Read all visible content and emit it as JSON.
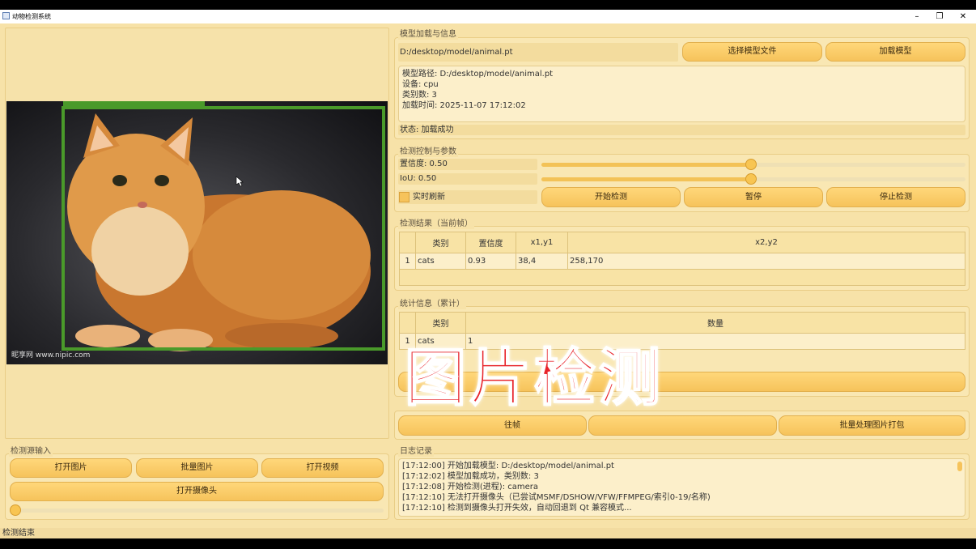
{
  "window": {
    "title": "动物检测系统",
    "min": "–",
    "restore": "❐",
    "close": "✕"
  },
  "model": {
    "group_title": "模型加载与信息",
    "path_field": "D:/desktop/model/animal.pt",
    "choose_button": "选择模型文件",
    "load_button": "加载模型",
    "info_lines": [
      "模型路径: D:/desktop/model/animal.pt",
      "设备: cpu",
      "类别数: 3",
      "加载时间: 2025-11-07 17:12:02"
    ],
    "status": "状态: 加载成功"
  },
  "control": {
    "group_title": "检测控制与参数",
    "confidence_label": "置信度: 0.50",
    "confidence_value": 0.5,
    "iou_label": "IoU: 0.50",
    "iou_value": 0.5,
    "realtime_label": "实时刷新",
    "start_button": "开始检测",
    "pause_button": "暂停",
    "stop_button": "停止检测"
  },
  "results": {
    "group_title": "检测结果（当前帧）",
    "headers": [
      "类别",
      "置信度",
      "x1,y1",
      "x2,y2"
    ],
    "rows": [
      {
        "num": "1",
        "class": "cats",
        "conf": "0.93",
        "xy1": "38,4",
        "xy2": "258,170"
      }
    ]
  },
  "stats": {
    "group_title": "统计信息（累计）",
    "headers": [
      "类别",
      "数量"
    ],
    "rows": [
      {
        "num": "1",
        "class": "cats",
        "count": "1"
      }
    ]
  },
  "export": {
    "frame_button_partial": "往帧",
    "batch_button": "批量处理图片打包"
  },
  "source": {
    "group_title": "检测源输入",
    "open_image": "打开图片",
    "batch_images": "批量图片",
    "open_video": "打开视频",
    "open_camera": "打开摄像头",
    "progress": 0
  },
  "log": {
    "group_title": "日志记录",
    "lines": [
      "[17:12:00] 开始加载模型: D:/desktop/model/animal.pt",
      "[17:12:02] 模型加载成功，类别数: 3",
      "[17:12:08] 开始检测(进程): camera",
      "[17:12:10] 无法打开摄像头（已尝试MSMF/DSHOW/VFW/FFMPEG/索引0-19/名称)",
      "[17:12:10] 检测到摄像头打开失效，自动回退到 Qt 兼容模式..."
    ]
  },
  "statusbar": "检测结束",
  "overlay": "图片检测",
  "image": {
    "watermark": "昵享网 www.nipic.com"
  },
  "colors": {
    "box": "#4a9a2a",
    "overlay": "#e8242a",
    "accent": "#f6c35b"
  }
}
